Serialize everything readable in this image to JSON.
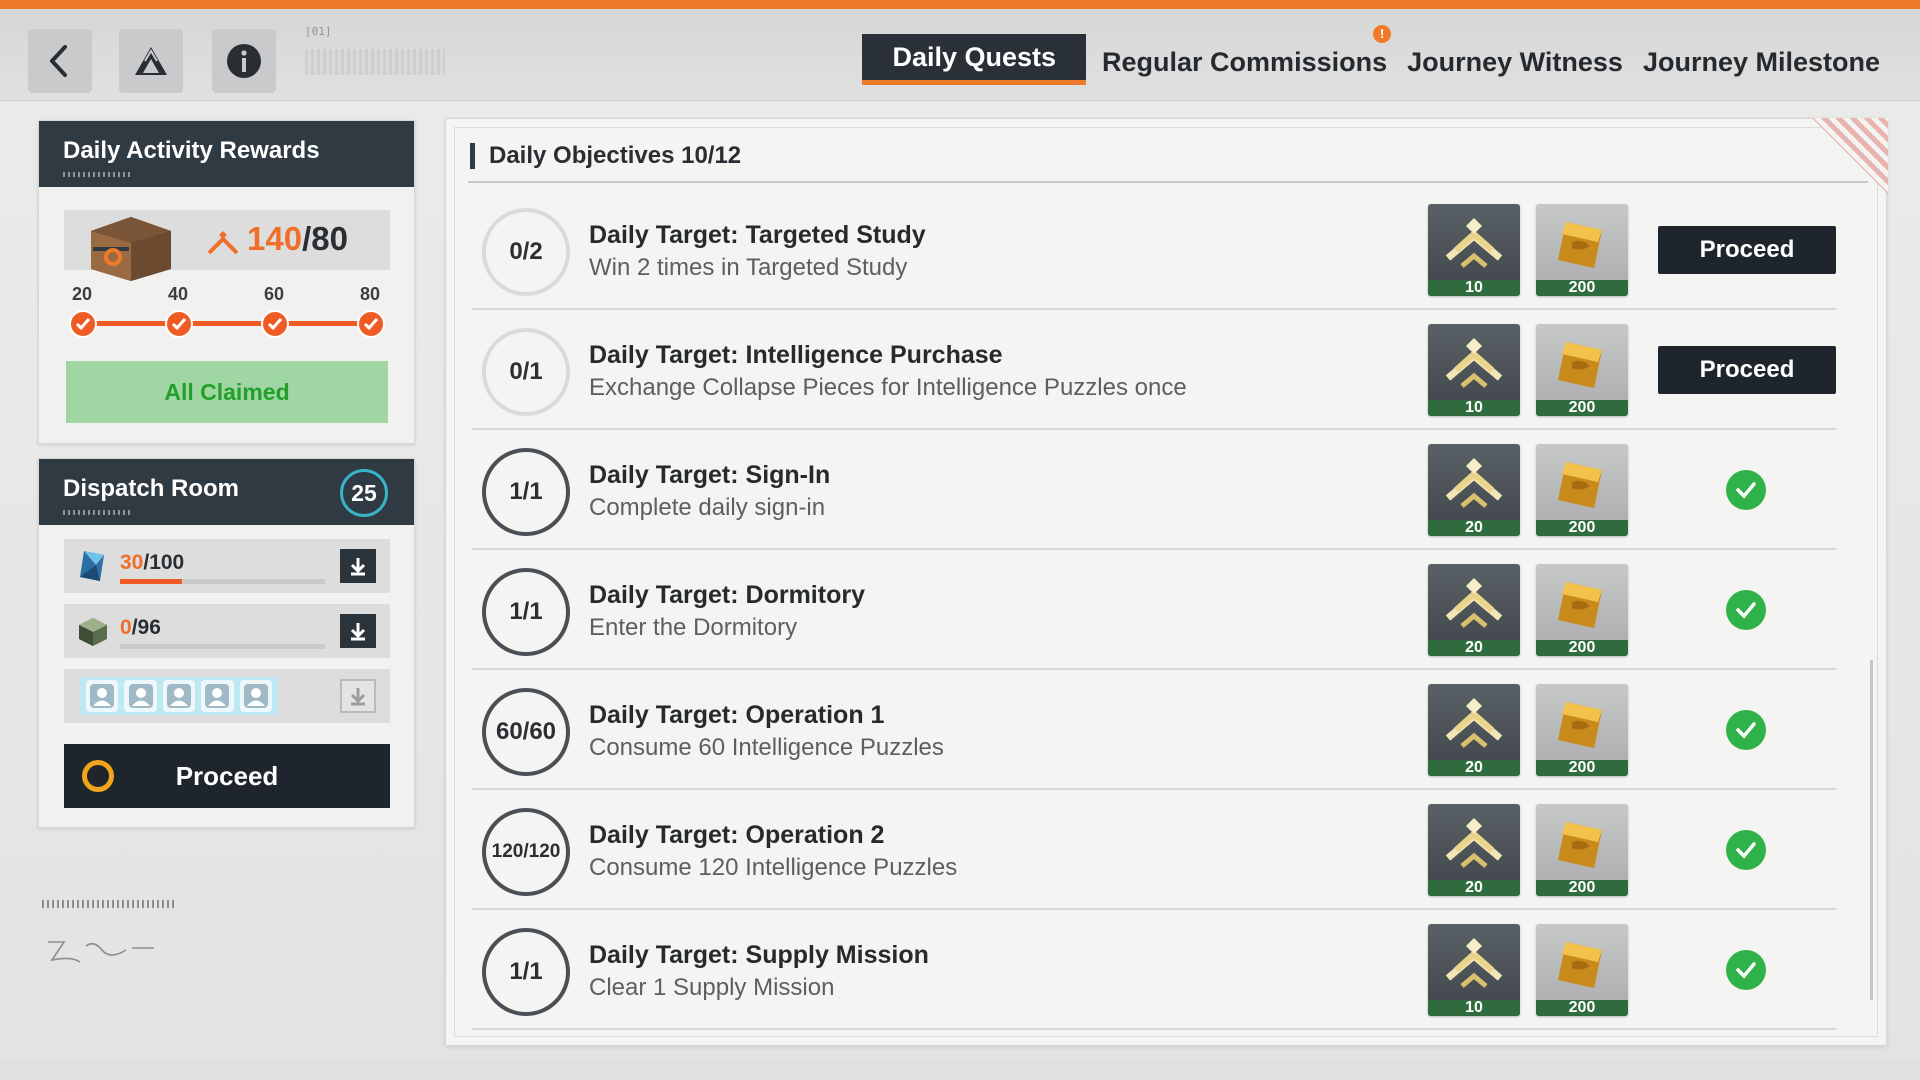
{
  "header": {
    "back_icon": "back-arrow-icon",
    "logo_icon": "triangle-logo-icon",
    "info_icon": "info-icon",
    "id_tag": "[01]",
    "tabs": [
      {
        "label": "Daily Quests",
        "active": true
      },
      {
        "label": "Regular Commissions",
        "active": false,
        "alert": "!"
      },
      {
        "label": "Journey Witness",
        "active": false
      },
      {
        "label": "Journey Milestone",
        "active": false
      }
    ]
  },
  "activity": {
    "title": "Daily Activity Rewards",
    "current": "140",
    "total": "/80",
    "milestones": [
      "20",
      "40",
      "60",
      "80"
    ],
    "claimed_label": "All Claimed"
  },
  "dispatch": {
    "title": "Dispatch Room",
    "badge": "25",
    "row1_current": "30",
    "row1_total": "/100",
    "row1_progress": 0.3,
    "row2_current": "0",
    "row2_total": "/96",
    "row2_progress": 0.0,
    "slots": 5,
    "proceed_label": "Proceed"
  },
  "objectives": {
    "title": "Daily Objectives 10/12",
    "reward_icons": [
      "activity-points-icon",
      "gold-ticket-icon"
    ],
    "rows": [
      {
        "progress": "0/2",
        "name": "Daily Target: Targeted Study",
        "desc": "Win 2 times in Targeted Study",
        "reward_a": "10",
        "reward_b": "200",
        "status": "proceed",
        "action": "Proceed"
      },
      {
        "progress": "0/1",
        "name": "Daily Target: Intelligence Purchase",
        "desc": "Exchange Collapse Pieces for Intelligence Puzzles once",
        "reward_a": "10",
        "reward_b": "200",
        "status": "proceed",
        "action": "Proceed"
      },
      {
        "progress": "1/1",
        "name": "Daily Target: Sign-In",
        "desc": "Complete daily sign-in",
        "reward_a": "20",
        "reward_b": "200",
        "status": "done"
      },
      {
        "progress": "1/1",
        "name": "Daily Target: Dormitory",
        "desc": "Enter the Dormitory",
        "reward_a": "20",
        "reward_b": "200",
        "status": "done"
      },
      {
        "progress": "60/60",
        "name": "Daily Target: Operation 1",
        "desc": "Consume 60 Intelligence Puzzles",
        "reward_a": "20",
        "reward_b": "200",
        "status": "done"
      },
      {
        "progress": "120/120",
        "name": "Daily Target: Operation 2",
        "desc": "Consume 120 Intelligence Puzzles",
        "reward_a": "20",
        "reward_b": "200",
        "status": "done"
      },
      {
        "progress": "1/1",
        "name": "Daily Target: Supply Mission",
        "desc": "Clear 1 Supply Mission",
        "reward_a": "10",
        "reward_b": "200",
        "status": "done"
      }
    ]
  },
  "colors": {
    "accent": "#ee7a2a",
    "dark": "#1e252c",
    "success": "#2fb24a",
    "claimed_bg": "#9fd6a3",
    "dispatch_ring": "#38b3c8"
  }
}
